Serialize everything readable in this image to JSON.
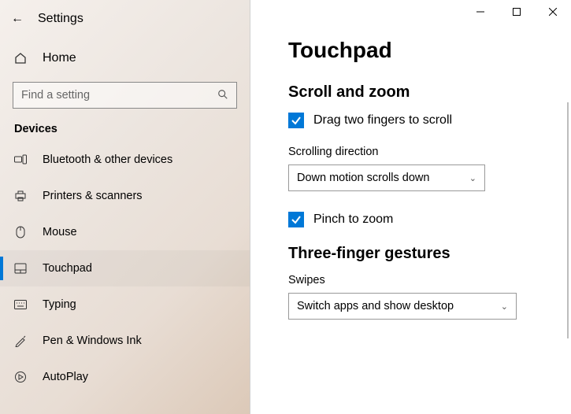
{
  "app_title": "Settings",
  "home_label": "Home",
  "search": {
    "placeholder": "Find a setting"
  },
  "category_header": "Devices",
  "nav": {
    "items": [
      {
        "label": "Bluetooth & other devices"
      },
      {
        "label": "Printers & scanners"
      },
      {
        "label": "Mouse"
      },
      {
        "label": "Touchpad"
      },
      {
        "label": "Typing"
      },
      {
        "label": "Pen & Windows Ink"
      },
      {
        "label": "AutoPlay"
      }
    ]
  },
  "page": {
    "title": "Touchpad",
    "scroll_zoom": {
      "heading": "Scroll and zoom",
      "drag_two_fingers": {
        "label": "Drag two fingers to scroll",
        "checked": true
      },
      "scrolling_direction": {
        "label": "Scrolling direction",
        "value": "Down motion scrolls down"
      },
      "pinch_to_zoom": {
        "label": "Pinch to zoom",
        "checked": true
      }
    },
    "three_finger": {
      "heading": "Three-finger gestures",
      "swipes": {
        "label": "Swipes",
        "value": "Switch apps and show desktop"
      }
    }
  },
  "colors": {
    "accent": "#0078d7"
  }
}
